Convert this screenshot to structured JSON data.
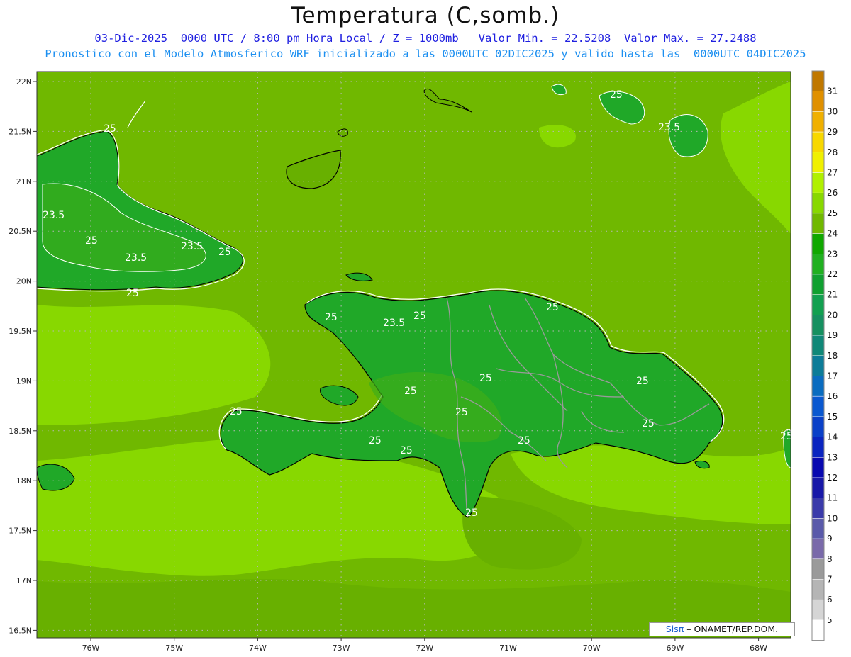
{
  "header": {
    "title": "Temperatura (C,somb.)",
    "subtitle1": "03-Dic-2025  0000 UTC / 8:00 pm Hora Local / Z = 1000mb   Valor Min. = 22.5208  Valor Max. = 27.2488",
    "subtitle2": "Pronostico con el Modelo Atmosferico WRF inicializado a las 0000UTC_02DIC2025 y valido hasta las  0000UTC_04DIC2025"
  },
  "axes": {
    "lat_labels": [
      "22N",
      "21.5N",
      "21N",
      "20.5N",
      "20N",
      "19.5N",
      "19N",
      "18.5N",
      "18N",
      "17.5N",
      "17N",
      "16.5N"
    ],
    "lon_labels": [
      "76W",
      "75W",
      "74W",
      "73W",
      "72W",
      "71W",
      "70W",
      "69W",
      "68W"
    ]
  },
  "colorbar": {
    "labels": [
      "31",
      "30",
      "29",
      "28",
      "27",
      "26",
      "25",
      "24",
      "23",
      "22",
      "21",
      "20",
      "19",
      "18",
      "17",
      "16",
      "15",
      "14",
      "13",
      "12",
      "11",
      "10",
      "9",
      "8",
      "7",
      "6",
      "5"
    ],
    "colors": [
      "#c07800",
      "#e09000",
      "#f0b000",
      "#f8d800",
      "#f0f000",
      "#b0f000",
      "#88d800",
      "#70b800",
      "#10a800",
      "#20b020",
      "#10a030",
      "#12a050",
      "#169060",
      "#108878",
      "#0c7c98",
      "#0a6cc0",
      "#0a58d0",
      "#0a40c8",
      "#0a24c0",
      "#0808b0",
      "#1818a8",
      "#3a3aaa",
      "#5a5aaa",
      "#7a6aaa",
      "#9a9a9a",
      "#b5b5b5",
      "#d5d5d5",
      "#ffffff"
    ]
  },
  "colors": {
    "sea": "#70b800",
    "land_warm": "#3eae18",
    "land": "#20a828",
    "sea_cool": "#88d800",
    "sea_dark": "#68b000"
  },
  "contour_labels": [
    "25",
    "23.5",
    "25",
    "25",
    "23.5",
    "25",
    "23.5",
    "23.5",
    "25",
    "25",
    "25",
    "25",
    "23.5",
    "25",
    "25",
    "25",
    "25",
    "25",
    "25",
    "25",
    "25",
    "25",
    "25",
    "25",
    "25"
  ],
  "credit": {
    "brand": "Sisπ",
    "text": " – ONAMET/REP.DOM."
  }
}
